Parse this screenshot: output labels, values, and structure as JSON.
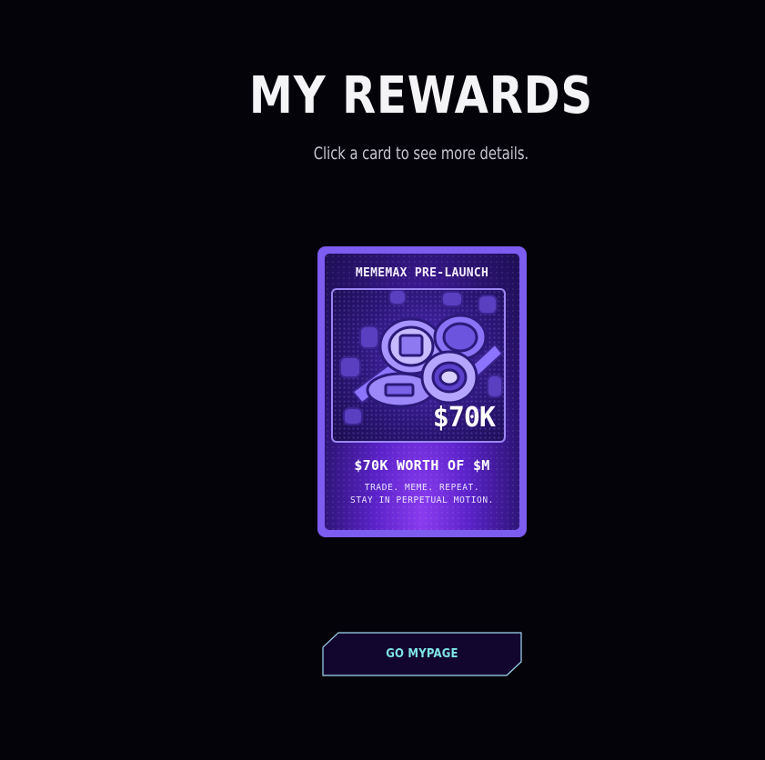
{
  "header": {
    "title": "MY REWARDS",
    "subtitle": "Click a card to see more details."
  },
  "rewards": {
    "cards": [
      {
        "title": "MEMEMAX PRE-LAUNCH",
        "value": "$70K",
        "worth": "$70K WORTH OF $M",
        "tagline_line1": "TRADE. MEME. REPEAT.",
        "tagline_line2": "STAY IN PERPETUAL MOTION.",
        "art_icon": "coins-pile-icon"
      }
    ]
  },
  "actions": {
    "go_mypage_label": "GO MYPAGE"
  },
  "colors": {
    "background": "#05030a",
    "card_frame": "#7d5cf0",
    "button_text": "#7fe3e6",
    "button_border": "#9fd8f0"
  }
}
